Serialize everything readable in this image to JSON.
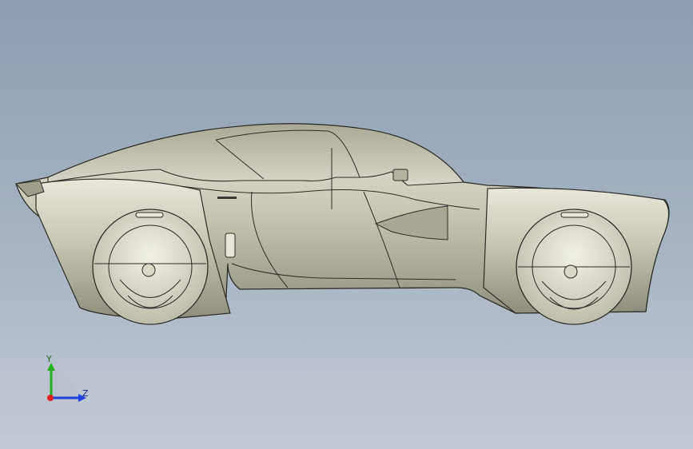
{
  "viewport": {
    "background_top": "#8d9db2",
    "background_bottom": "#c3cad4",
    "model": "concept-car-side-view",
    "model_color": "#c9c8b6",
    "edge_color": "#2b2b26"
  },
  "triad": {
    "y_label": "Y",
    "z_label": "Z",
    "x_color": "#e02020",
    "y_color": "#20b020",
    "z_color": "#2040e0"
  }
}
